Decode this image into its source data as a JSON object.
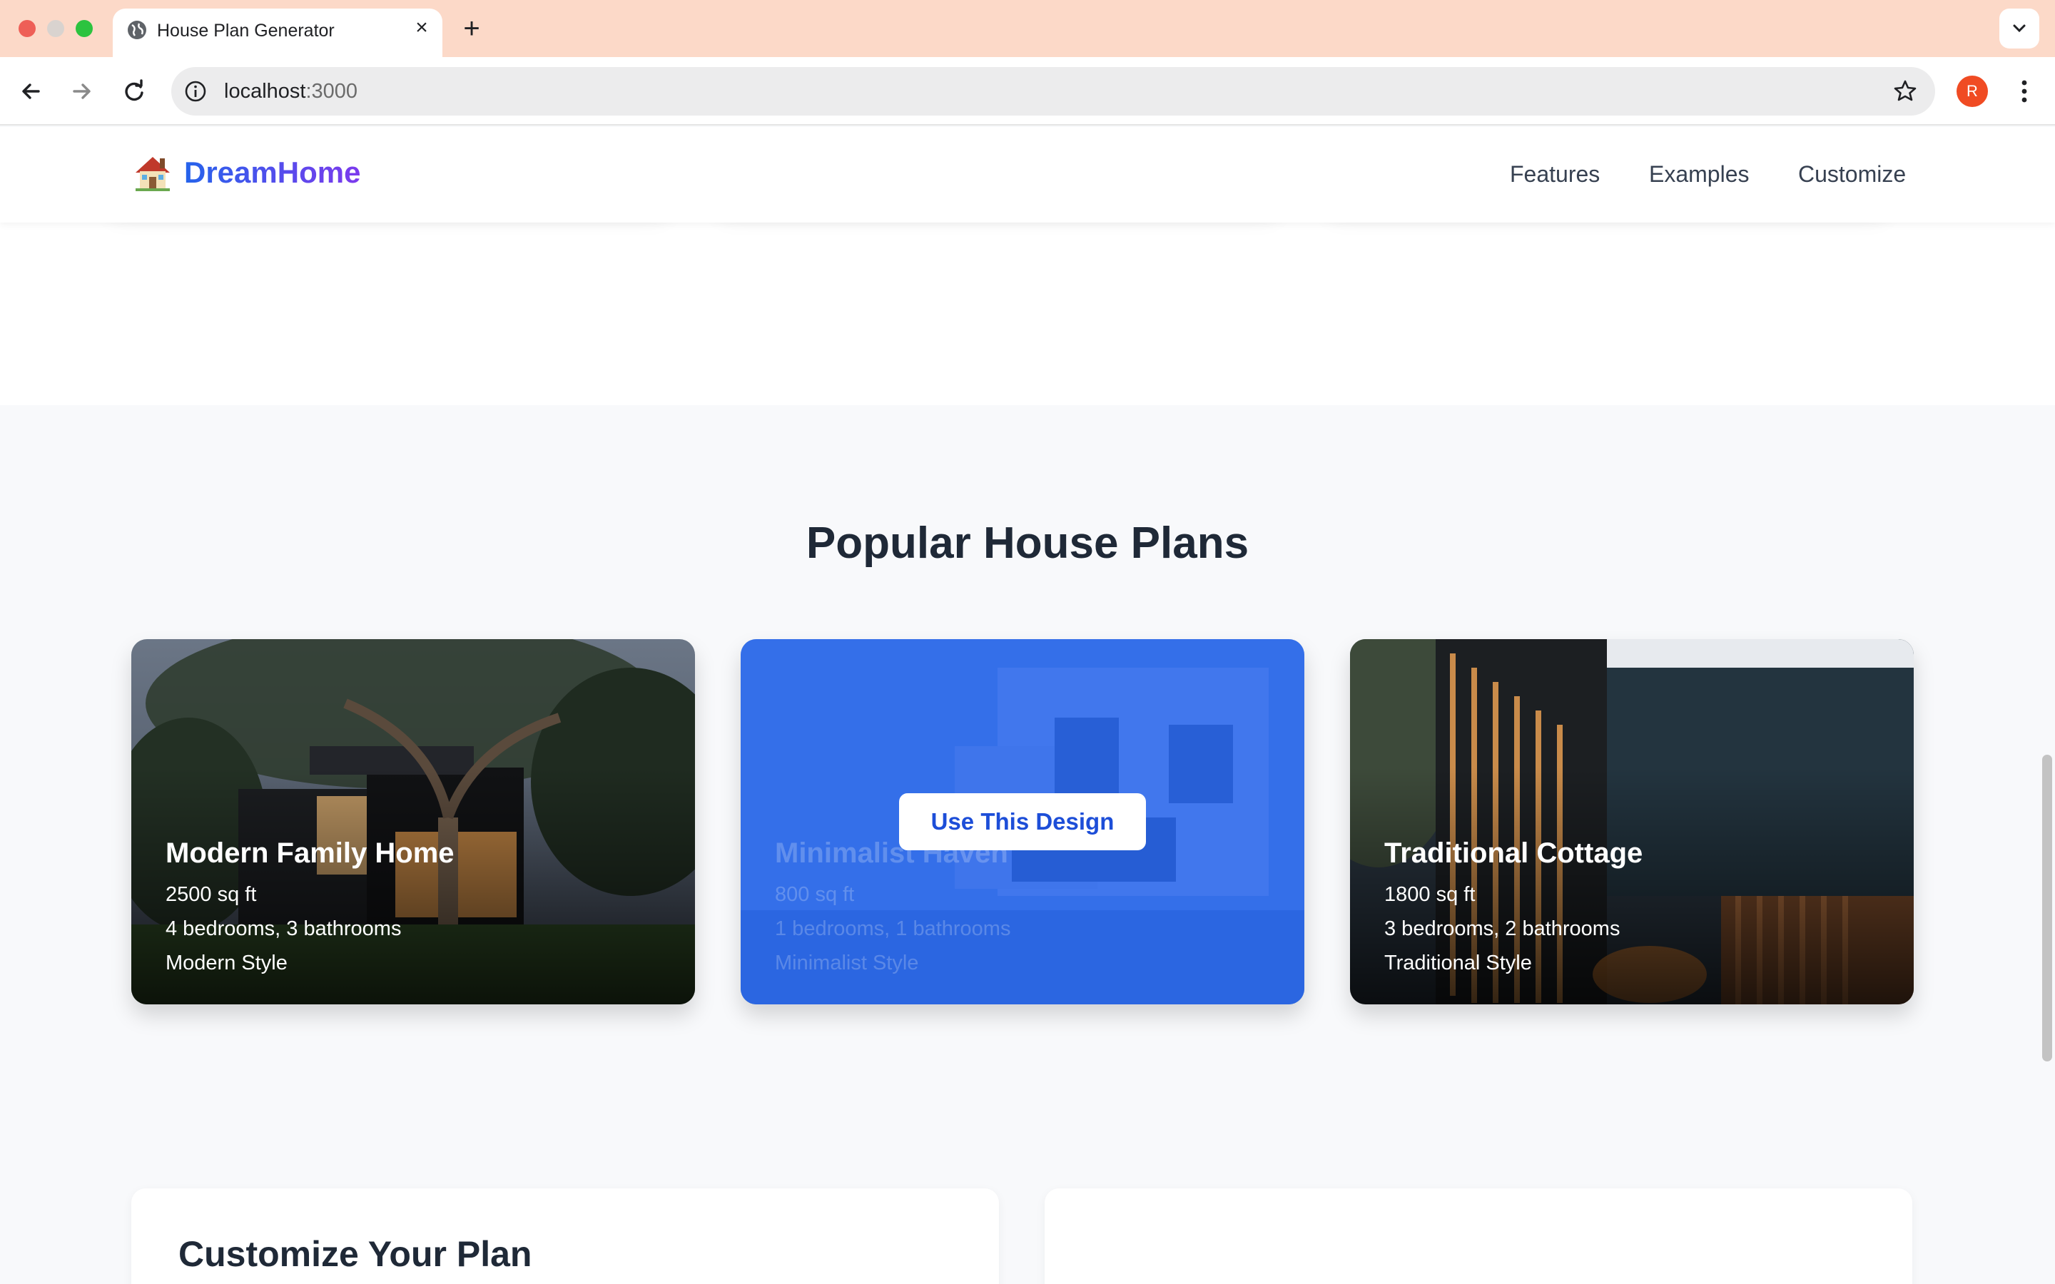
{
  "browser": {
    "tab_title": "House Plan Generator",
    "url_host": "localhost",
    "url_port": ":3000",
    "profile_initial": "R"
  },
  "site": {
    "logo_text": "DreamHome",
    "nav": [
      "Features",
      "Examples",
      "Customize"
    ]
  },
  "plans_section": {
    "title": "Popular House Plans",
    "cards": [
      {
        "title": "Modern Family Home",
        "area": "2500 sq ft",
        "rooms": "4 bedrooms, 3 bathrooms",
        "style": "Modern Style"
      },
      {
        "title": "Minimalist Haven",
        "area": "800 sq ft",
        "rooms": "1 bedrooms, 1 bathrooms",
        "style": "Minimalist Style",
        "hover_button": "Use This Design"
      },
      {
        "title": "Traditional Cottage",
        "area": "1800 sq ft",
        "rooms": "3 bedrooms, 2 bathrooms",
        "style": "Traditional Style"
      }
    ]
  },
  "customize": {
    "title": "Customize Your Plan"
  },
  "colors": {
    "tabbar": "#fcd9c8",
    "brand_blue": "#2563eb",
    "brand_purple": "#7c3aed",
    "hover_blue": "#2563eb"
  }
}
